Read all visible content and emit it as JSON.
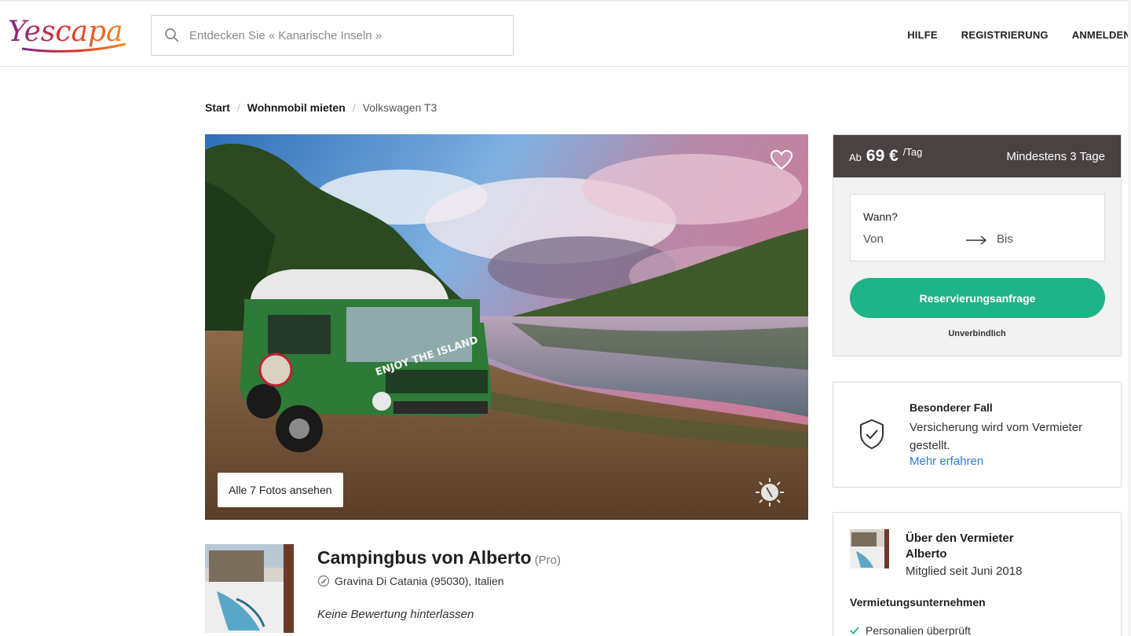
{
  "header": {
    "logo_text": "Yescapa",
    "search_placeholder": "Entdecken Sie « Kanarische Inseln »",
    "nav": [
      "HILFE",
      "REGISTRIERUNG",
      "ANMELDEN"
    ]
  },
  "breadcrumb": [
    "Start",
    "Wohnmobil mieten",
    "Volkswagen T3"
  ],
  "hero": {
    "photos_button": "Alle 7 Fotos ansehen",
    "van_slogan": "ENJOY THE ISLAND"
  },
  "listing": {
    "title": "Campingbus von Alberto",
    "pro_tag": "(Pro)",
    "location": "Gravina Di Catania (95030), Italien",
    "review_text": "Keine Bewertung hinterlassen"
  },
  "booking": {
    "from_label": "Ab",
    "price": "69 €",
    "per_day": "/Tag",
    "min_days": "Mindestens 3 Tage",
    "when_label": "Wann?",
    "from_date": "Von",
    "to_date": "Bis",
    "reserve_button": "Reservierungsanfrage",
    "non_binding": "Unverbindlich"
  },
  "insurance": {
    "title": "Besonderer Fall",
    "text": "Versicherung wird vom Vermieter gestellt.",
    "link": "Mehr erfahren"
  },
  "owner": {
    "heading_line1": "Über den Vermieter",
    "heading_line2": "Alberto",
    "member_since": "Mitglied seit Juni 2018",
    "company_label": "Vermietungsunternehmen",
    "verified": "Personalien überprüft"
  },
  "colors": {
    "accent": "#1fb388",
    "price_bar": "#4a4242",
    "link": "#2b7bd6"
  }
}
